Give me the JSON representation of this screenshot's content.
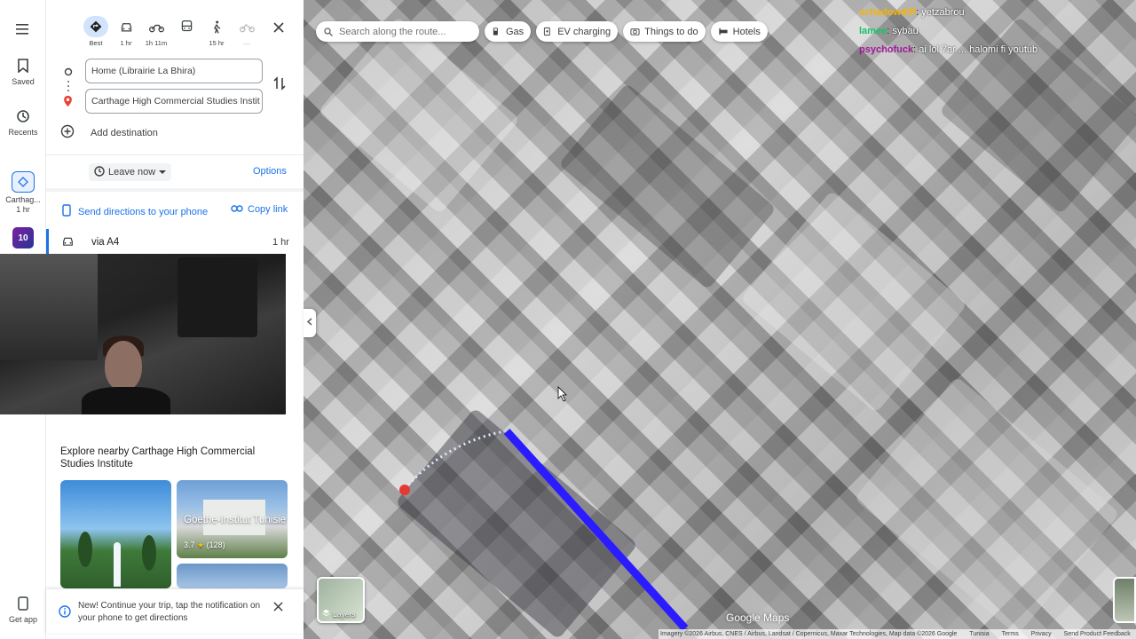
{
  "rail": {
    "menu_icon": "menu-icon",
    "saved_label": "Saved",
    "recents_label": "Recents",
    "active_item_label": "Carthag...",
    "active_item_sub": "1 hr",
    "badge_count": "10",
    "get_app_label": "Get app"
  },
  "modes": [
    {
      "name": "best",
      "label": "Best",
      "active": true
    },
    {
      "name": "car",
      "label": "1 hr"
    },
    {
      "name": "motorcycle",
      "label": "1h 11m"
    },
    {
      "name": "transit",
      "label": ""
    },
    {
      "name": "walk",
      "label": "15 hr"
    },
    {
      "name": "bike",
      "label": "—"
    }
  ],
  "directions": {
    "origin": "Home (Librairie La Bhira)",
    "destination": "Carthage High Commercial Studies Instit",
    "add_destination": "Add destination",
    "leave_now": "Leave now",
    "options": "Options",
    "send_to_phone": "Send directions to your phone",
    "copy_link": "Copy link"
  },
  "route": {
    "via": "via A4",
    "duration": "1 hr"
  },
  "explore": {
    "title": "Explore nearby Carthage High Commercial Studies Institute",
    "cards": [
      {
        "name": "",
        "rating": "",
        "reviews": ""
      },
      {
        "name": "Goethe-Institut Tunisie",
        "rating": "3.7",
        "reviews": "(128)"
      }
    ]
  },
  "notification": {
    "text": "New! Continue your trip, tap the notification on your phone to get directions"
  },
  "map": {
    "search_placeholder": "Search along the route...",
    "chips": [
      "Gas",
      "EV charging",
      "Things to do",
      "Hotels"
    ],
    "layers_label": "Layers",
    "brand": "Google Maps",
    "attribution": "Imagery ©2026 Airbus, CNES / Airbus, Landsat / Copernicus, Maxar Technologies, Map data ©2026 Google",
    "links": [
      "Tunisia",
      "Terms",
      "Privacy",
      "Send Product Feedback"
    ]
  },
  "chat": [
    {
      "user": "schadowdiff",
      "msg": "yetzabrou",
      "color": "#f5b400"
    },
    {
      "user": "lamee",
      "msg": "sybau",
      "color": "#19c26b"
    },
    {
      "user": "psychofuck",
      "msg": "ai lol 7ar ... halomi fi youtub",
      "color": "#a0189a"
    }
  ],
  "colors": {
    "accent": "#1a73e8",
    "route": "#2a1cff",
    "pin": "#e53935"
  }
}
